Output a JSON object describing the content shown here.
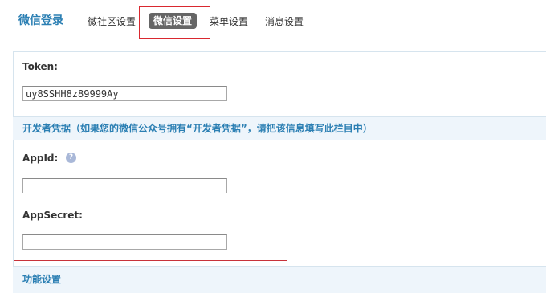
{
  "nav": {
    "title": "微信登录",
    "tabs": [
      {
        "label": "微社区设置"
      },
      {
        "label": "微信设置"
      },
      {
        "label": "菜单设置"
      },
      {
        "label": "消息设置"
      }
    ]
  },
  "token": {
    "label": "Token:",
    "value": "uy8SSHH8z89999Ay"
  },
  "credentials": {
    "header": "开发者凭据（如果您的微信公众号拥有“开发者凭据”，请把该信息填写此栏目中）",
    "appid_label": "AppId:",
    "appid_value": "",
    "help_icon_glyph": "?",
    "appsecret_label": "AppSecret:",
    "appsecret_value": ""
  },
  "features": {
    "header": "功能设置"
  },
  "colors": {
    "accent": "#2b7fb3",
    "active_tab_bg": "#666666",
    "section_bg": "#eef5fb",
    "annotation_red": "#d9282f"
  }
}
